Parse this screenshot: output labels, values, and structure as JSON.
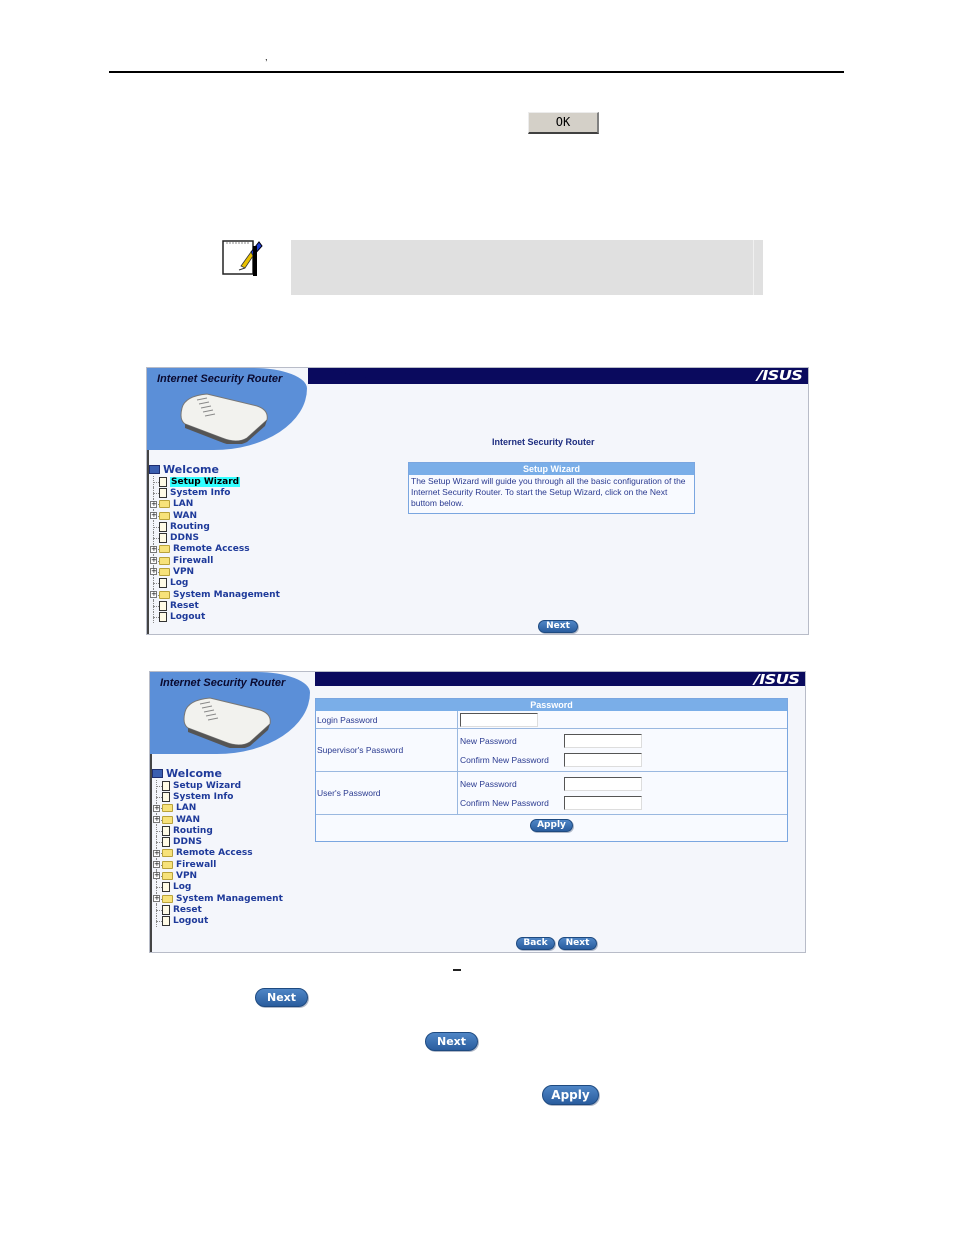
{
  "page_header": {
    "mark": ","
  },
  "dialog": {
    "ok_label": "OK"
  },
  "note": {
    "icon": "note-pen-icon",
    "text": ""
  },
  "screenshot1": {
    "product_title": "Internet Security Router",
    "brand": "/ISUS",
    "tree": {
      "root": "Welcome",
      "items": [
        {
          "label": "Setup Wizard",
          "type": "doc",
          "expandable": false,
          "selected": true
        },
        {
          "label": "System Info",
          "type": "doc",
          "expandable": false
        },
        {
          "label": "LAN",
          "type": "folder",
          "expandable": true
        },
        {
          "label": "WAN",
          "type": "folder",
          "expandable": true
        },
        {
          "label": "Routing",
          "type": "doc",
          "expandable": false
        },
        {
          "label": "DDNS",
          "type": "doc",
          "expandable": false
        },
        {
          "label": "Remote Access",
          "type": "folder",
          "expandable": true
        },
        {
          "label": "Firewall",
          "type": "folder",
          "expandable": true
        },
        {
          "label": "VPN",
          "type": "folder",
          "expandable": true
        },
        {
          "label": "Log",
          "type": "doc",
          "expandable": false
        },
        {
          "label": "System Management",
          "type": "folder",
          "expandable": true
        },
        {
          "label": "Reset",
          "type": "doc",
          "expandable": false
        },
        {
          "label": "Logout",
          "type": "doc",
          "expandable": false
        }
      ]
    },
    "heading": "Internet Security Router",
    "wizard": {
      "title": "Setup Wizard",
      "body": "The Setup Wizard will guide you through all the basic configuration of the Internet Security Router. To start the Setup Wizard, click on the Next buttom below."
    },
    "next_label": "Next"
  },
  "screenshot2": {
    "product_title": "Internet Security Router",
    "brand": "/ISUS",
    "tree_root": "Welcome",
    "password_table": {
      "title": "Password",
      "login_label": "Login Password",
      "login_value": "",
      "supervisor_label": "Supervisor's Password",
      "user_label": "User's Password",
      "new_label": "New Password",
      "confirm_label": "Confirm New Password",
      "apply_label": "Apply"
    },
    "back_label": "Back",
    "next_label": "Next"
  },
  "inline_buttons": {
    "next1": "Next",
    "next2": "Next",
    "apply": "Apply"
  },
  "colors": {
    "navy": "#0a0a5e",
    "table_header": "#7aaee8",
    "link_text": "#1e3a9a",
    "button": "#2a5d9e",
    "selected": "#33ffff"
  }
}
